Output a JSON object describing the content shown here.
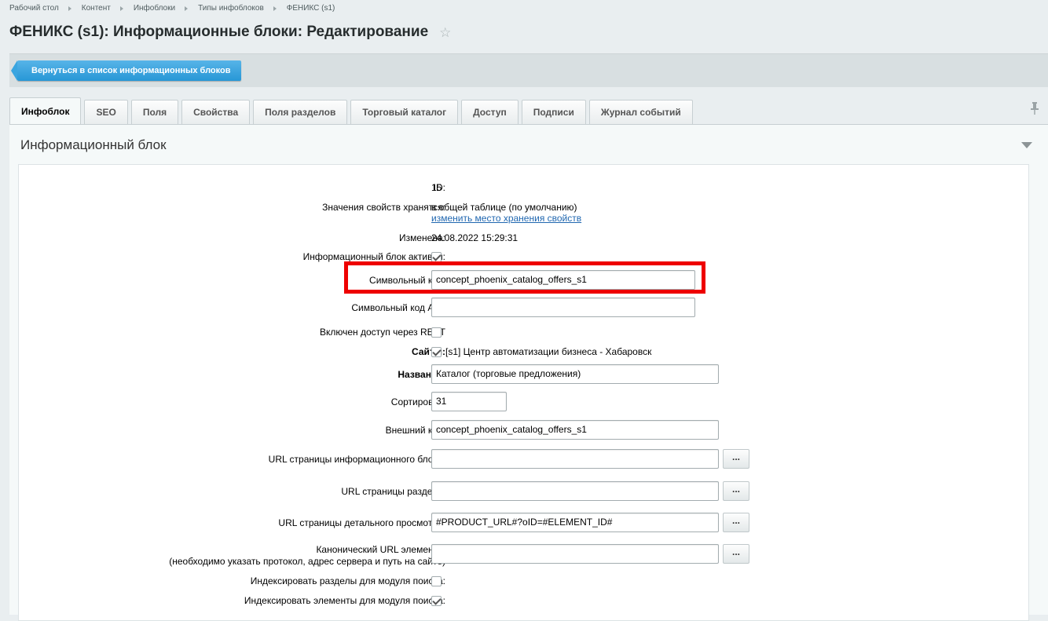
{
  "breadcrumb": [
    "Рабочий стол",
    "Контент",
    "Инфоблоки",
    "Типы инфоблоков",
    "ФЕНИКС (s1)"
  ],
  "page_title": "ФЕНИКС (s1): Информационные блоки: Редактирование",
  "back_button": "Вернуться в список информационных блоков",
  "tabs": [
    "Инфоблок",
    "SEO",
    "Поля",
    "Свойства",
    "Поля разделов",
    "Торговый каталог",
    "Доступ",
    "Подписи",
    "Журнал событий"
  ],
  "section_title": "Информационный блок",
  "form": {
    "id_label": "ID:",
    "id_value": "15",
    "storage_label": "Значения свойств хранятся:",
    "storage_value": "в общей таблице (по умолчанию)",
    "storage_link": "изменить место хранения свойств",
    "changed_label": "Изменена:",
    "changed_value": "24.08.2022 15:29:31",
    "active_label": "Информационный блок активен:",
    "code_label": "Символьный код:",
    "code_value": "concept_phoenix_catalog_offers_s1",
    "api_code_label": "Символьный код API:",
    "api_code_value": "",
    "rest_label": "Включен доступ через REST",
    "sites_label": "Сайты:",
    "sites_value": "[s1] Центр автоматизации бизнеса - Хабаровск",
    "name_label": "Название:",
    "name_value": "Каталог (торговые предложения)",
    "sort_label": "Сортировка:",
    "sort_value": "31",
    "xml_id_label": "Внешний код:",
    "xml_id_value": "concept_phoenix_catalog_offers_s1",
    "list_url_label": "URL страницы информационного блока:",
    "list_url_value": "",
    "section_url_label": "URL страницы раздела:",
    "section_url_value": "",
    "detail_url_label": "URL страницы детального просмотра:",
    "detail_url_value": "#PRODUCT_URL#?oID=#ELEMENT_ID#",
    "canonical_label_1": "Канонический URL элемента:",
    "canonical_label_2": "(необходимо указать протокол, адрес сервера и путь на сайте)",
    "canonical_value": "",
    "index_sections_label": "Индексировать разделы для модуля поиска:",
    "index_elements_label": "Индексировать элементы для модуля поиска:",
    "dots": "..."
  }
}
